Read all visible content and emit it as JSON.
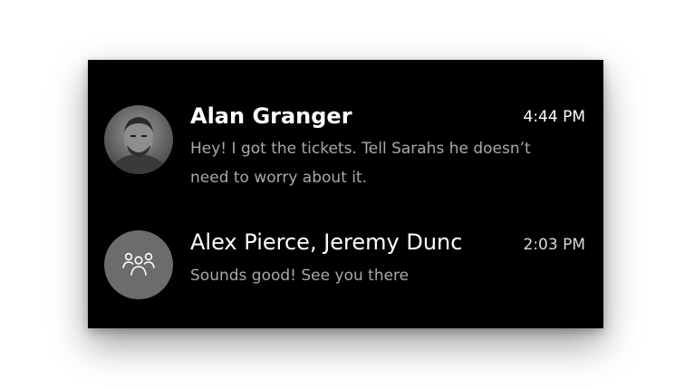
{
  "conversations": [
    {
      "name": "Alan Granger",
      "time": "4:44 PM",
      "preview": "Hey! I got the tickets. Tell Sarahs he doesn’t need to worry about it.",
      "avatar": "person-photo"
    },
    {
      "name": "Alex Pierce, Jeremy Dunc",
      "time": "2:03 PM",
      "preview": "Sounds good! See you there",
      "avatar": "group-people-icon"
    }
  ],
  "colors": {
    "panel_background": "#000000",
    "page_background": "#ffffff",
    "primary_text": "#ffffff",
    "secondary_text": "#a9a9a9",
    "group_avatar": "#6c6c6c"
  }
}
